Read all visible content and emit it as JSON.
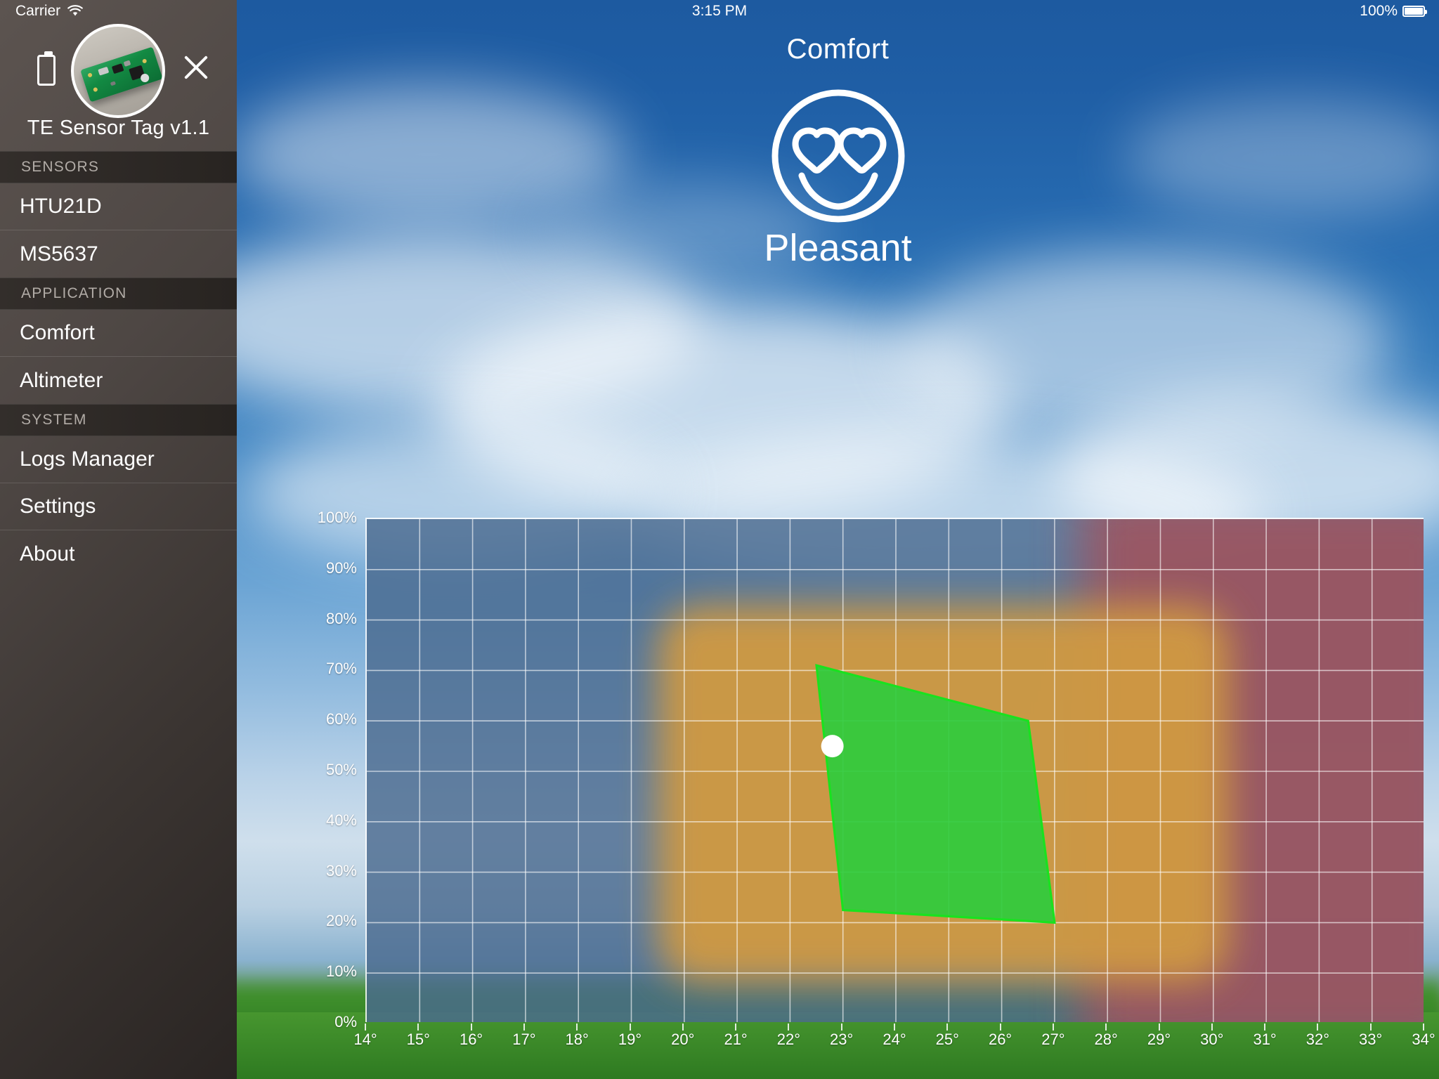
{
  "statusbar": {
    "carrier": "Carrier",
    "wifi_icon": "wifi-icon",
    "time": "3:15 PM",
    "battery_percent": "100%",
    "battery_icon": "battery-full-icon"
  },
  "sidebar": {
    "battery_icon": "battery-icon",
    "device_photo": "sensor-tag-board-photo",
    "close_icon": "close-icon",
    "device_name": "TE Sensor Tag v1.1",
    "sections": [
      {
        "header": "SENSORS",
        "items": [
          "HTU21D",
          "MS5637"
        ]
      },
      {
        "header": "APPLICATION",
        "items": [
          "Comfort",
          "Altimeter"
        ]
      },
      {
        "header": "SYSTEM",
        "items": [
          "Logs Manager",
          "Settings",
          "About"
        ]
      }
    ]
  },
  "main": {
    "title": "Comfort",
    "status_icon": "heart-eyes-smiley-icon",
    "status_label": "Pleasant"
  },
  "chart_data": {
    "type": "scatter",
    "title": "Comfort",
    "xlabel": "",
    "ylabel": "",
    "xlim": [
      14,
      34
    ],
    "ylim": [
      0,
      100
    ],
    "x_ticks": [
      "14°",
      "15°",
      "16°",
      "17°",
      "18°",
      "19°",
      "20°",
      "21°",
      "22°",
      "23°",
      "24°",
      "25°",
      "26°",
      "27°",
      "28°",
      "29°",
      "30°",
      "31°",
      "32°",
      "33°",
      "34°"
    ],
    "y_ticks": [
      "0%",
      "10%",
      "20%",
      "30%",
      "40%",
      "50%",
      "60%",
      "70%",
      "80%",
      "90%",
      "100%"
    ],
    "grid": true,
    "legend": "none",
    "current_point": {
      "label": "current-reading",
      "temperature_c": 22.8,
      "humidity_pct": 55,
      "color": "#ffffff"
    },
    "zones": [
      {
        "name": "cold",
        "color": "#4a6a8f",
        "x_range": [
          14,
          34
        ],
        "y_range": [
          0,
          100
        ]
      },
      {
        "name": "hot",
        "color": "#9d5560",
        "x_range": [
          27.5,
          34
        ],
        "y_range": [
          0,
          100
        ]
      },
      {
        "name": "moderate",
        "color": "#d09a43",
        "x_range": [
          19.5,
          30.3
        ],
        "y_range": [
          8,
          83
        ]
      },
      {
        "name": "comfort",
        "color": "#2ee03e",
        "polygon_xy": [
          [
            22.5,
            71
          ],
          [
            26.5,
            60
          ],
          [
            27.0,
            20
          ],
          [
            23.0,
            22.5
          ]
        ]
      }
    ],
    "colors": {
      "comfort_fill": "#2ecc3d",
      "comfort_stroke": "#19e21f",
      "grid_line": "#ffffff",
      "axis_line": "#ffffff"
    }
  }
}
